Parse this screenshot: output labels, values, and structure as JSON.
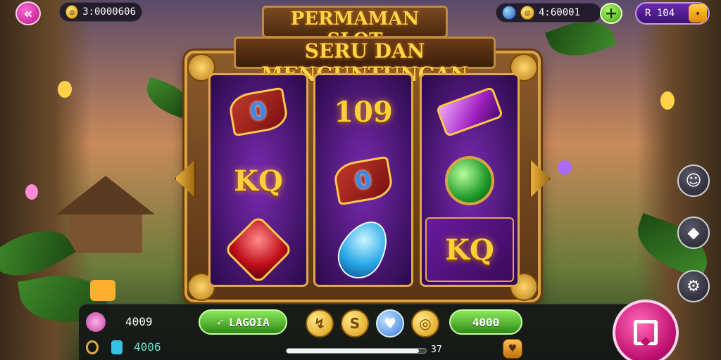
{
  "title": {
    "line1": "PERMAMAN SLOT",
    "line2": "SERU DAN MENGUNTUNGAN"
  },
  "hud": {
    "back_icon": "back-arrow-icon",
    "coins_value": "3:0000606",
    "gems_value": "4:60001",
    "vip_value": "R 104"
  },
  "reels": [
    {
      "symbols": [
        {
          "type": "gold-leaf",
          "text": "0"
        },
        {
          "type": "text",
          "text": "KQ"
        },
        {
          "type": "red-gem",
          "text": ""
        }
      ]
    },
    {
      "symbols": [
        {
          "type": "text",
          "text": "109"
        },
        {
          "type": "gold-leaf",
          "text": "0"
        },
        {
          "type": "blue-gem",
          "text": ""
        }
      ]
    },
    {
      "symbols": [
        {
          "type": "purple-gem",
          "text": ""
        },
        {
          "type": "green-gem",
          "text": ""
        },
        {
          "type": "kq-panel",
          "text": "KQ"
        }
      ]
    }
  ],
  "bottom": {
    "balance": "4009",
    "sub_balance": "4006",
    "left_button_label": "LAGOIA",
    "right_button_label": "4000",
    "chips": [
      "↯",
      "S",
      "♥",
      "◎"
    ],
    "progress_label": "37",
    "progress_fraction": 0.95
  },
  "side_buttons": [
    "chat-icon",
    "map-icon",
    "settings-icon"
  ],
  "colors": {
    "accent_gold": "#ffd64a",
    "spin_pink": "#c01070",
    "reel_purple": "#7a2ab0",
    "button_green": "#2e8a14"
  }
}
